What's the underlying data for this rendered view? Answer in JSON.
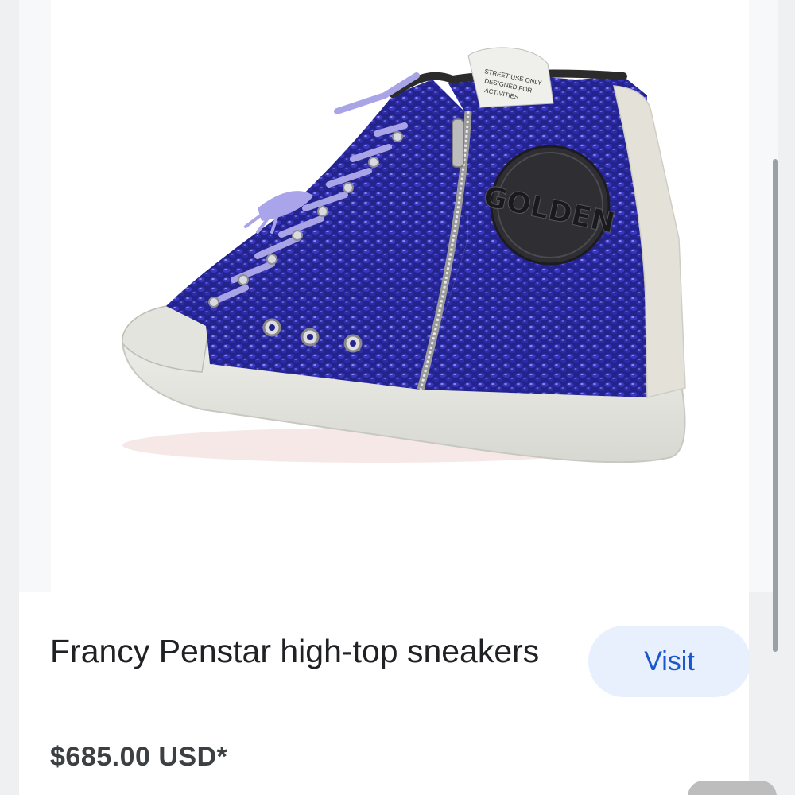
{
  "product": {
    "title": "Francy Penstar high-top sneakers",
    "price": "$685.00 USD*",
    "image_icon": "sneaker-image",
    "logo_text": "GOLDEN",
    "tag_text": "FOR STREET USE ONLY"
  },
  "actions": {
    "visit_label": "Visit"
  },
  "colors": {
    "sequin_blue": "#2a2a9e",
    "lace_lavender": "#a9a4e6",
    "sole_white": "#e9e9e4",
    "button_bg": "#e8f0fe",
    "button_text": "#1a57c9"
  }
}
